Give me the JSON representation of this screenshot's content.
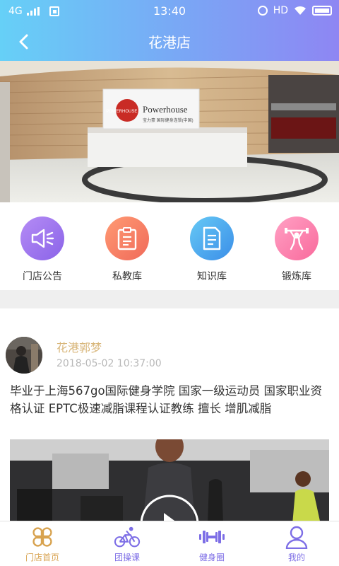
{
  "status_bar": {
    "network": "4G",
    "time": "13:40",
    "hd": "HD"
  },
  "navbar": {
    "title": "花港店",
    "back_icon": "chevron-left-icon"
  },
  "banner": {
    "sign_brand": "Powerhouse",
    "sign_sub": "宝力豪 国际健身连锁(中国)",
    "logo_text": "POWERHOUSE GYM"
  },
  "features": [
    {
      "label": "门店公告",
      "icon": "megaphone-icon",
      "color_from": "#b58cf5",
      "color_to": "#8a63e8"
    },
    {
      "label": "私教库",
      "icon": "clipboard-icon",
      "color_from": "#ff9a73",
      "color_to": "#f06a5a"
    },
    {
      "label": "知识库",
      "icon": "document-icon",
      "color_from": "#66c9f5",
      "color_to": "#3b8ee8"
    },
    {
      "label": "锻炼库",
      "icon": "weightlifter-icon",
      "color_from": "#ffa0c4",
      "color_to": "#f96a9c"
    }
  ],
  "post": {
    "author": "花港郭梦",
    "time": "2018-05-02 10:37:00",
    "content": "毕业于上海567go国际健身学院 国家一级运动员 国家职业资格认证 EPTC极速减脂课程认证教练 擅长  增肌减脂"
  },
  "tabbar": [
    {
      "label": "门店首页",
      "icon": "clover-icon",
      "active": true
    },
    {
      "label": "团操课",
      "icon": "cyclist-icon",
      "active": false
    },
    {
      "label": "健身圈",
      "icon": "dumbbell-icon",
      "active": false
    },
    {
      "label": "我的",
      "icon": "user-icon",
      "active": false
    }
  ],
  "colors": {
    "active_tab": "#d8a350",
    "inactive_tab": "#7d6ee6",
    "author": "#d8b67a",
    "header_from": "#66d0f7",
    "header_to": "#8e86f3"
  }
}
